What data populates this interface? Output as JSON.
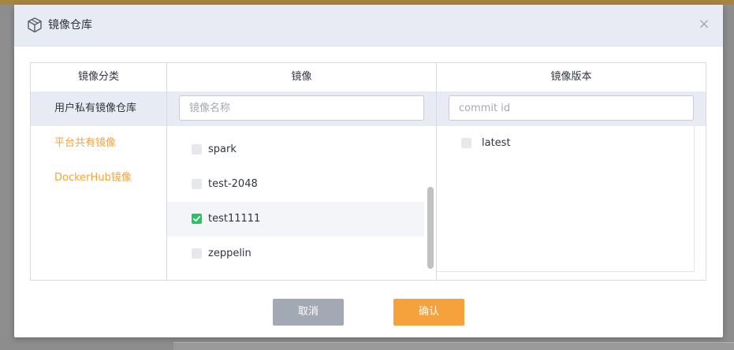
{
  "dialog": {
    "title": "镜像仓库",
    "close_symbol": "×",
    "header_icon": "box-icon"
  },
  "categories": {
    "header": "镜像分类",
    "items": [
      {
        "label": "用户私有镜像仓库",
        "active": true
      },
      {
        "label": "平台共有镜像",
        "active": false
      },
      {
        "label": "DockerHub镜像",
        "active": false
      }
    ]
  },
  "images": {
    "header": "镜像",
    "search_placeholder": "镜像名称",
    "items": [
      {
        "label": "spark",
        "checked": false
      },
      {
        "label": "test-2048",
        "checked": false
      },
      {
        "label": "test11111",
        "checked": true
      },
      {
        "label": "zeppelin",
        "checked": false
      }
    ]
  },
  "versions": {
    "header": "镜像版本",
    "search_placeholder": "commit id",
    "items": [
      {
        "label": "latest",
        "checked": false
      }
    ]
  },
  "actions": {
    "cancel_label": "取消",
    "confirm_label": "确认"
  },
  "colors": {
    "accent": "#f5a23c",
    "check": "#26c463",
    "header_bg": "#e9ebf4"
  }
}
